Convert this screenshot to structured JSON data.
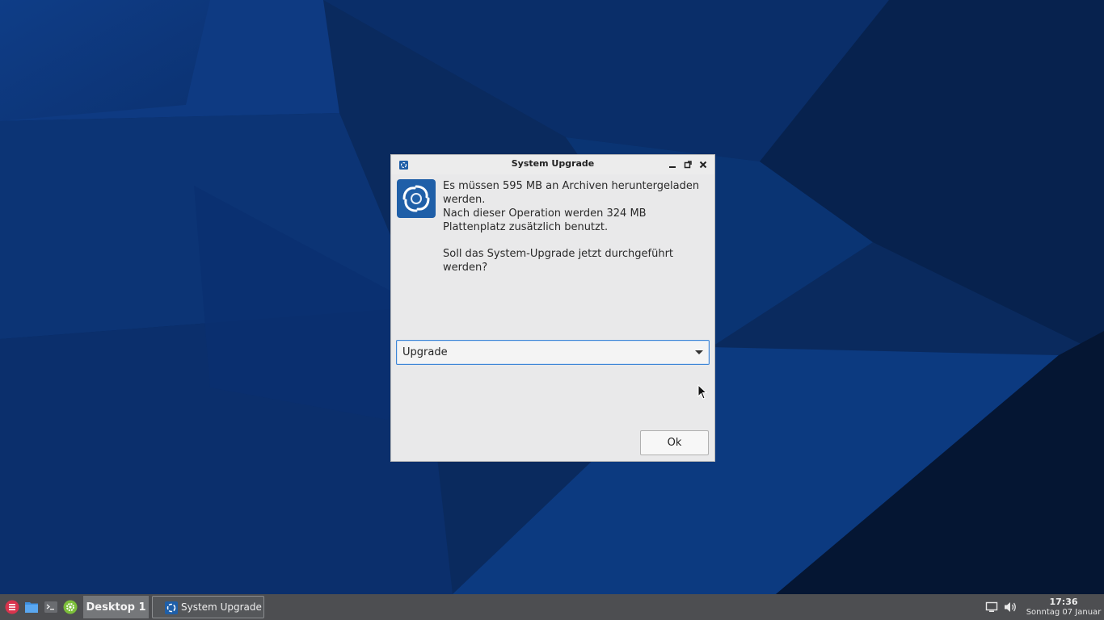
{
  "window": {
    "title": "System Upgrade",
    "app_icon": "system-upgrade-icon"
  },
  "dialog": {
    "message_line1": "Es müssen 595 MB an Archiven heruntergeladen werden.",
    "message_line2": "Nach dieser Operation werden 324 MB Plattenplatz zusätzlich benutzt.",
    "question": "Soll das System-Upgrade jetzt durchgeführt werden?",
    "combo_value": "Upgrade",
    "ok_label": "Ok"
  },
  "taskbar": {
    "workspace_label": "Desktop 1",
    "task_label": "System Upgrade",
    "clock_time": "17:36",
    "clock_date": "Sonntag 07 Januar"
  },
  "colors": {
    "desktop_bg": "#0a2454",
    "taskbar_bg": "#4d4e51",
    "accent": "#3f86d6",
    "app_icon_blue": "#1f5fa8"
  }
}
